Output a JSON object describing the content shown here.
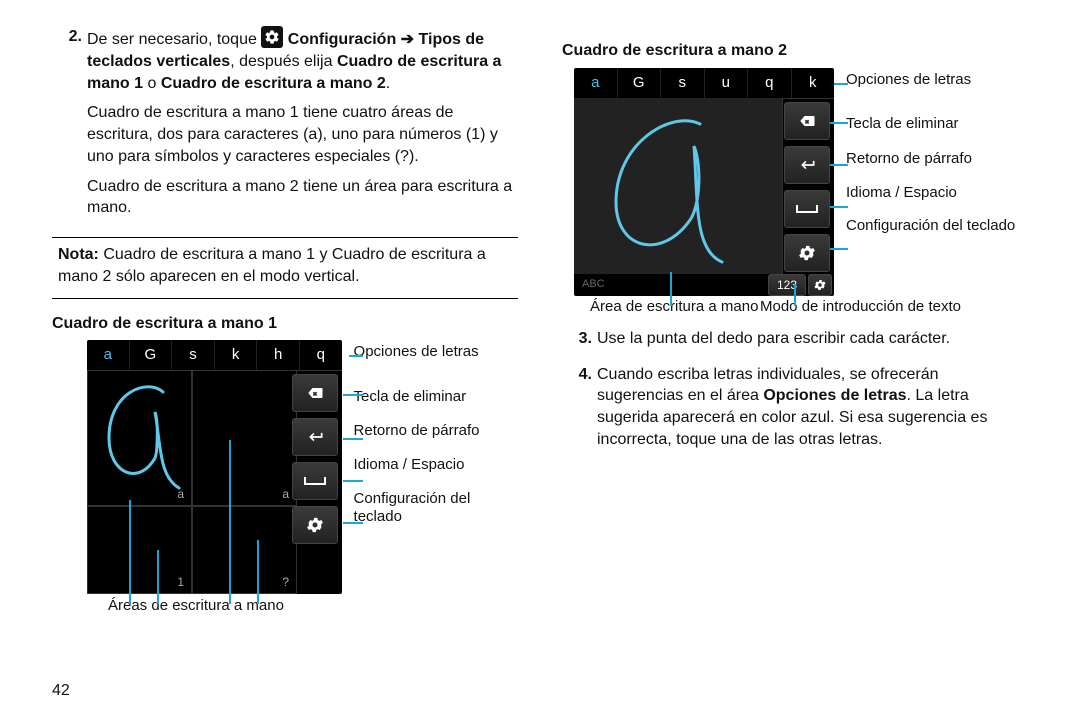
{
  "col_left": {
    "step2_num": "2.",
    "step2_line1a": "De ser necesario, toque ",
    "step2_line1b": " Configuración ➔ Tipos de teclados verticales",
    "step2_line1c": ", después elija ",
    "step2_line1d": "Cuadro de escritura a mano 1",
    "step2_line1e": " o ",
    "step2_line1f": "Cuadro de escritura a mano 2",
    "step2_line1g": ".",
    "para1": "Cuadro de escritura a mano 1 tiene cuatro áreas de escritura, dos para caracteres (a), uno para números (1) y uno para símbolos y caracteres especiales (?).",
    "para2": "Cuadro de escritura a mano 2 tiene un área para escritura a mano.",
    "note_label": "Nota:",
    "note_text": " Cuadro de escritura a mano 1 y Cuadro de escritura a mano 2 sólo aparecen en el modo vertical.",
    "heading1": "Cuadro de escritura a mano 1",
    "letters1": [
      "a",
      "G",
      "s",
      "k",
      "h",
      "q"
    ],
    "sub_labels": {
      "a1": "a",
      "a2": "a",
      "c": "1",
      "d": "?"
    },
    "annot": {
      "letters": "Opciones de letras",
      "delete": "Tecla de eliminar",
      "return": "Retorno de párrafo",
      "space": "Idioma / Espacio",
      "settings": "Configuración del teclado"
    },
    "below1": "Áreas de escritura a mano",
    "page_num": "42"
  },
  "col_right": {
    "heading2": "Cuadro de escritura a mano 2",
    "letters2": [
      "a",
      "G",
      "s",
      "u",
      "q",
      "k"
    ],
    "abc": "ABC",
    "mode_num": "123",
    "annot": {
      "letters": "Opciones de letras",
      "delete": "Tecla de eliminar",
      "return": "Retorno de párrafo",
      "space": "Idioma / Espacio",
      "settings": "Configuración del teclado"
    },
    "below_left": "Área de escritura a mano",
    "below_right": "Modo de introducción de texto",
    "step3_num": "3.",
    "step3": "Use la punta del dedo para escribir cada carácter.",
    "step4_num": "4.",
    "step4_a": "Cuando escriba letras individuales, se ofrecerán sugerencias en el área ",
    "step4_b": "Opciones de letras",
    "step4_c": ". La letra sugerida aparecerá en color azul. Si esa sugerencia es incorrecta, toque una de las otras letras."
  }
}
